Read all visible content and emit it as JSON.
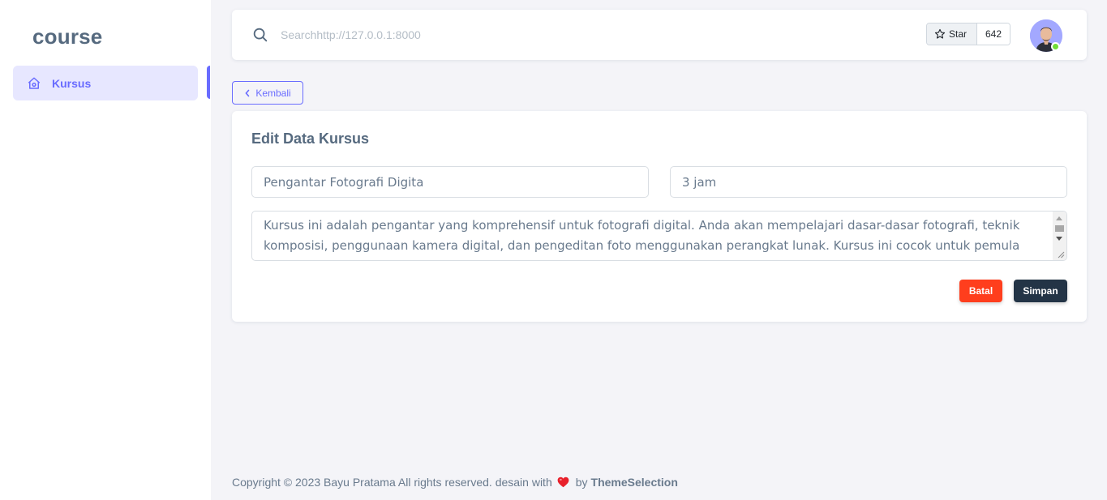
{
  "sidebar": {
    "brand": "course",
    "items": [
      {
        "label": "Kursus",
        "icon": "home-icon",
        "active": true
      }
    ]
  },
  "navbar": {
    "search_placeholder": "Searchhttp://127.0.0.1:8000",
    "github": {
      "star_label": "Star",
      "star_count": "642"
    },
    "avatar": {
      "status": "online"
    }
  },
  "back_button": {
    "label": "Kembali"
  },
  "form": {
    "title": "Edit Data Kursus",
    "course_name": "Pengantar Fotografi Digita",
    "duration": "3 jam",
    "description": "Kursus ini adalah pengantar yang komprehensif untuk fotografi digital. Anda akan mempelajari dasar-dasar fotografi, teknik komposisi, penggunaan kamera digital, dan pengeditan foto menggunakan perangkat lunak. Kursus ini cocok untuk pemula yang ingin memahami prinsip-prinsip dasar fotografi digital.",
    "cancel_label": "Batal",
    "save_label": "Simpan"
  },
  "footer": {
    "text": "Copyright © 2023 Bayu Pratama All rights reserved. desain with",
    "by": "by",
    "brand": "ThemeSelection"
  },
  "colors": {
    "primary": "#696cff",
    "danger": "#ff3e1d",
    "dark": "#233446",
    "online": "#71dd37"
  }
}
